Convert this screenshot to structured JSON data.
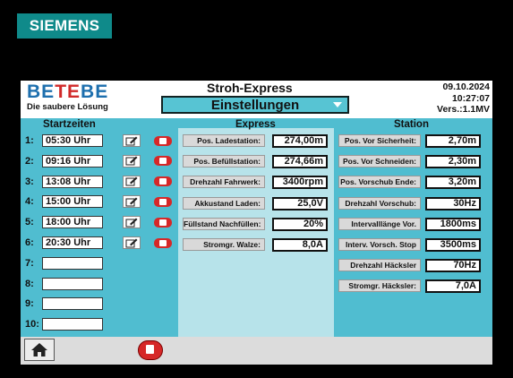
{
  "device_brand": "SIEMENS",
  "logo": {
    "brand_blue_1": "BE",
    "brand_red": "TE",
    "brand_blue_2": "BE",
    "slogan": "Die saubere Lösung"
  },
  "header": {
    "title": "Stroh-Express",
    "menu_selected": "Einstellungen",
    "date": "09.10.2024",
    "time": "10:27:07",
    "version": "Vers.:1.1MV"
  },
  "columns": {
    "start_times": "Startzeiten",
    "express": "Express",
    "station": "Station"
  },
  "start_times": [
    {
      "label": "1:",
      "value": "05:30 Uhr"
    },
    {
      "label": "2:",
      "value": "09:16 Uhr"
    },
    {
      "label": "3:",
      "value": "13:08 Uhr"
    },
    {
      "label": "4:",
      "value": "15:00 Uhr"
    },
    {
      "label": "5:",
      "value": "18:00 Uhr"
    },
    {
      "label": "6:",
      "value": "20:30 Uhr"
    },
    {
      "label": "7:",
      "value": ""
    },
    {
      "label": "8:",
      "value": ""
    },
    {
      "label": "9:",
      "value": ""
    },
    {
      "label": "10:",
      "value": ""
    }
  ],
  "express": [
    {
      "label": "Pos. Ladestation:",
      "value": "274,00m"
    },
    {
      "label": "Pos. Befüllstation:",
      "value": "274,66m"
    },
    {
      "label": "Drehzahl Fahrwerk:",
      "value": "3400rpm"
    },
    {
      "label": "Akkustand Laden:",
      "value": "25,0V"
    },
    {
      "label": "Füllstand Nachfüllen:",
      "value": "20%"
    },
    {
      "label": "Stromgr. Walze:",
      "value": "8,0A"
    }
  ],
  "station": [
    {
      "label": "Pos. Vor Sicherheit:",
      "value": "2,70m"
    },
    {
      "label": "Pos. Vor Schneiden:",
      "value": "2,30m"
    },
    {
      "label": "Pos. Vorschub Ende:",
      "value": "3,20m"
    },
    {
      "label": "Drehzahl Vorschub:",
      "value": "30Hz"
    },
    {
      "label": "Intervalllänge Vor.",
      "value": "1800ms"
    },
    {
      "label": "Interv. Vorsch. Stop",
      "value": "3500ms"
    },
    {
      "label": "Drehzahl Häcksler",
      "value": "70Hz"
    },
    {
      "label": "Stromgr. Häcksler:",
      "value": "7,0A"
    }
  ],
  "icons": {
    "edit": "edit-icon",
    "delete": "delete-icon",
    "home": "home-icon",
    "delete_all": "delete-all-icon",
    "dropdown": "chevron-down-icon"
  },
  "colors": {
    "panel_bg": "#50bdd0",
    "express_bg": "#b7e3ea",
    "logo_blue": "#1d6fae",
    "logo_red": "#d12a2a",
    "brand_teal": "#0f8a8a",
    "delete_red": "#d62828"
  }
}
